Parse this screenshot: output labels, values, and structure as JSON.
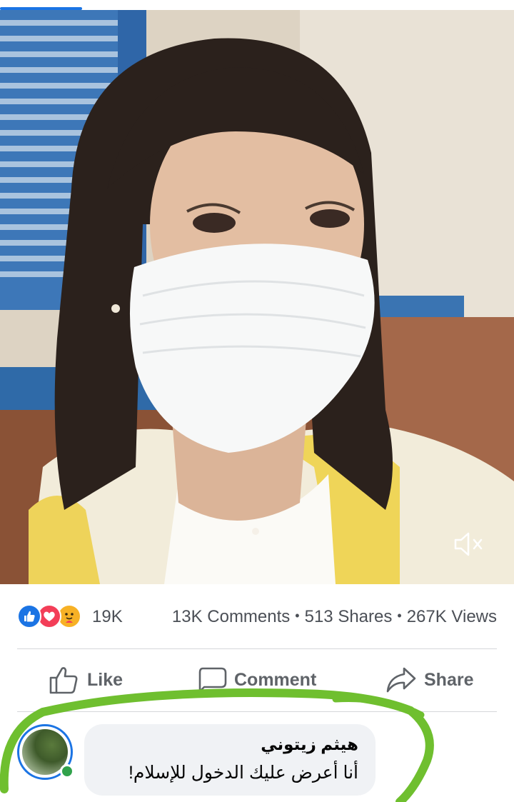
{
  "video": {
    "progress_fraction": 0.16,
    "mute_icon": "speaker-muted-icon"
  },
  "stats": {
    "reactions": [
      {
        "name": "like-reaction-icon",
        "color": "#1b74e4"
      },
      {
        "name": "love-reaction-icon",
        "color": "#f33e58"
      },
      {
        "name": "care-reaction-icon",
        "color": "#f7b125"
      }
    ],
    "reaction_count": "19K",
    "comments": "13K Comments",
    "separator": "•",
    "shares": "513 Shares",
    "views": "267K Views"
  },
  "actions": {
    "like": "Like",
    "comment": "Comment",
    "share": "Share"
  },
  "comment": {
    "author": "هيثم زيتوني",
    "text": "أنا أعرض عليك الدخول للإسلام!"
  },
  "colors": {
    "accent": "#1b74e4",
    "highlight_stroke": "#6fbf2f",
    "online": "#31a24c",
    "bubble": "#f0f2f5"
  }
}
